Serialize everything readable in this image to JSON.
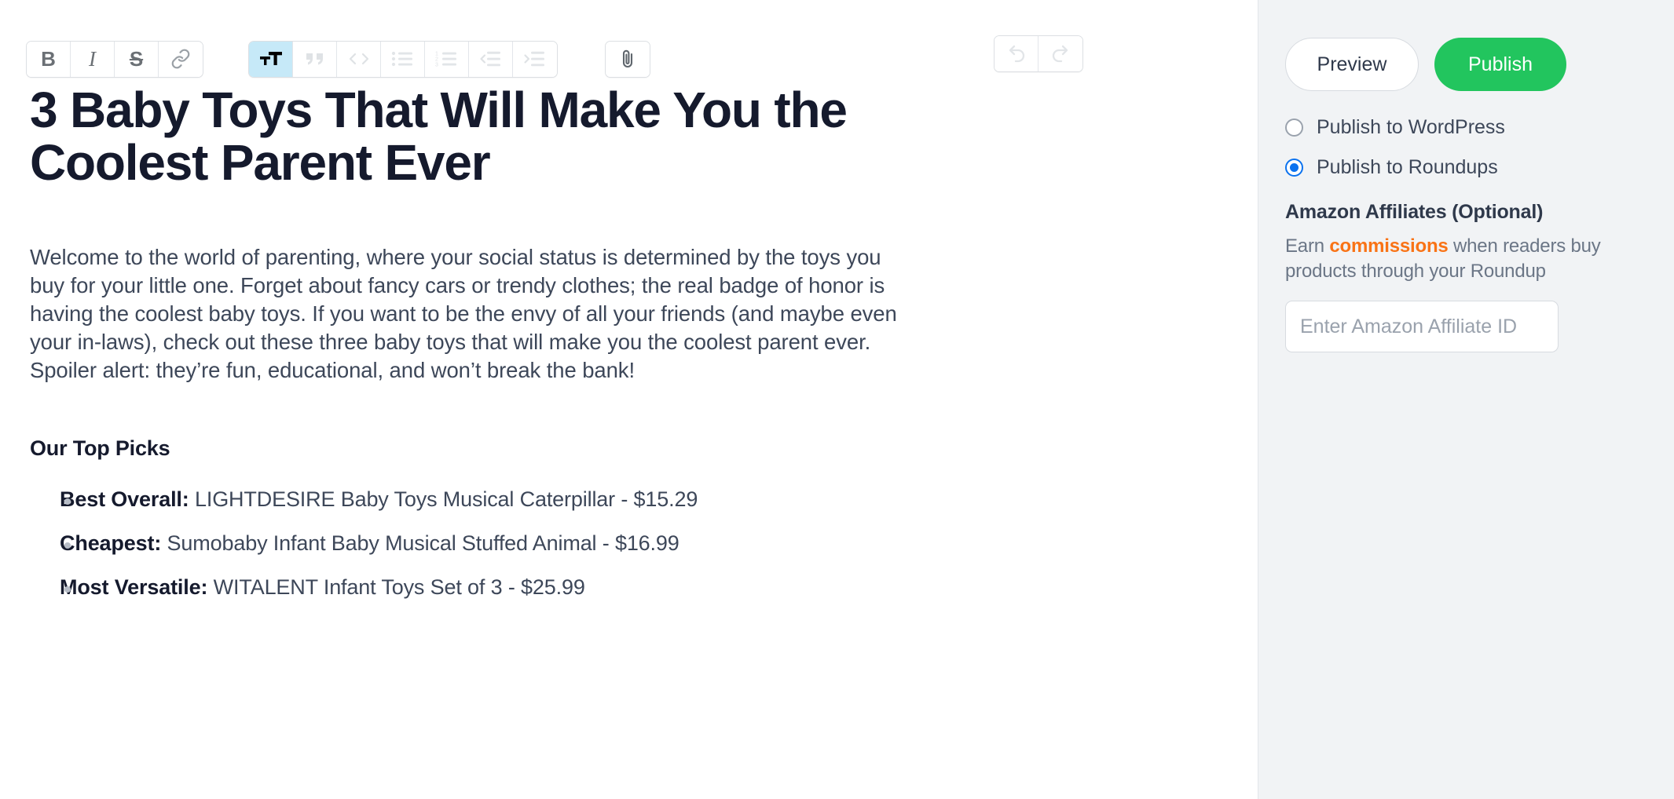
{
  "toolbar": {
    "groups": [
      {
        "name": "text-format",
        "buttons": [
          {
            "name": "bold-icon",
            "label": "B",
            "active": false
          },
          {
            "name": "italic-icon",
            "label": "I",
            "active": false
          },
          {
            "name": "strikethrough-icon",
            "label": "S",
            "active": false
          },
          {
            "name": "link-icon",
            "label": "link",
            "active": false
          }
        ]
      },
      {
        "name": "block-format",
        "buttons": [
          {
            "name": "heading-icon",
            "label": "TT",
            "active": true
          },
          {
            "name": "blockquote-icon",
            "label": "quote",
            "active": false
          },
          {
            "name": "code-block-icon",
            "label": "code",
            "active": false
          },
          {
            "name": "bulleted-list-icon",
            "label": "bullet list",
            "active": false
          },
          {
            "name": "numbered-list-icon",
            "label": "numbered list",
            "active": false
          },
          {
            "name": "outdent-icon",
            "label": "outdent",
            "active": false
          },
          {
            "name": "indent-icon",
            "label": "indent",
            "active": false
          }
        ]
      },
      {
        "name": "attachment",
        "buttons": [
          {
            "name": "paperclip-icon",
            "label": "attach",
            "active": false
          }
        ]
      },
      {
        "name": "history",
        "buttons": [
          {
            "name": "undo-icon",
            "label": "undo",
            "active": false
          },
          {
            "name": "redo-icon",
            "label": "redo",
            "active": false
          }
        ]
      }
    ]
  },
  "article": {
    "title": "3 Baby Toys That Will Make You the Coolest Parent Ever",
    "paragraph": "Welcome to the world of parenting, where your social status is determined by the toys you buy for your little one. Forget about fancy cars or trendy clothes; the real badge of honor is having the coolest baby toys. If you want to be the envy of all your friends (and maybe even your in-laws), check out these three baby toys that will make you the coolest parent ever. Spoiler alert: they’re fun, educational, and won’t break the bank!",
    "subheading": "Our Top Picks",
    "picks": [
      {
        "label": "Best Overall:",
        "text": " LIGHTDESIRE Baby Toys Musical Caterpillar - $15.29"
      },
      {
        "label": "Cheapest:",
        "text": " Sumobaby Infant Baby Musical Stuffed Animal - $16.99"
      },
      {
        "label": "Most Versatile:",
        "text": " WITALENT Infant Toys Set of 3 - $25.99"
      }
    ]
  },
  "sidebar": {
    "preview_label": "Preview",
    "publish_label": "Publish",
    "radios": [
      {
        "label": "Publish to WordPress",
        "checked": false
      },
      {
        "label": "Publish to Roundups",
        "checked": true
      }
    ],
    "affiliates": {
      "title": "Amazon Affiliates (Optional)",
      "desc_before": "Earn ",
      "desc_highlight": "commissions",
      "desc_after": " when readers buy products through your Roundup",
      "input_value": "",
      "input_placeholder": "Enter Amazon Affiliate ID"
    }
  },
  "colors": {
    "publish_green": "#22c55e",
    "radio_blue": "#0b72ef",
    "highlight_orange": "#f97316",
    "active_tool_blue": "#c6e9f8",
    "sidebar_bg": "#f1f3f5",
    "heading_navy": "#151a2d",
    "body_slate": "#3d4759"
  }
}
